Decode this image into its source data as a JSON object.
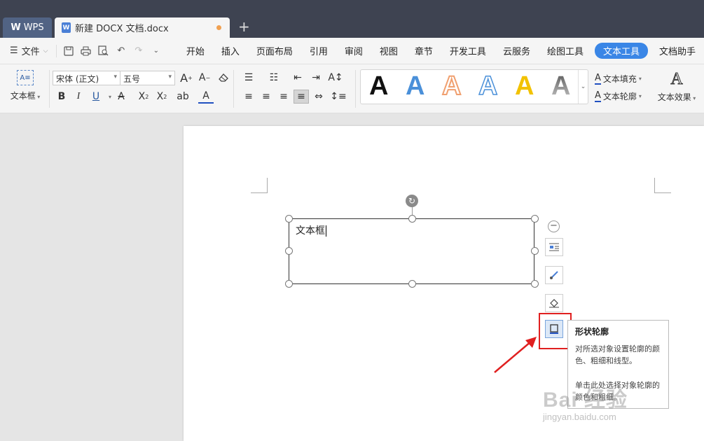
{
  "titlebar": {
    "app_tab": "WPS",
    "doc_tab": "新建 DOCX 文档.docx",
    "new_tab": "+"
  },
  "menu": {
    "file_label": "文件",
    "tabs": [
      "开始",
      "插入",
      "页面布局",
      "引用",
      "审阅",
      "视图",
      "章节",
      "开发工具",
      "云服务",
      "绘图工具",
      "文本工具",
      "文档助手"
    ],
    "active_tab": "文本工具"
  },
  "ribbon": {
    "textbox_label": "文本框",
    "font_name": "宋体 (正文)",
    "font_size": "五号",
    "text_fill": "文本填充",
    "text_outline": "文本轮廓",
    "text_effect": "文本效果",
    "style_gallery": [
      {
        "glyph": "A",
        "color": "#111111"
      },
      {
        "glyph": "A",
        "color": "#4a90d9"
      },
      {
        "glyph": "A",
        "color": "#f0a070"
      },
      {
        "glyph": "A",
        "color": "#ffffff"
      },
      {
        "glyph": "A",
        "color": "#f2c200"
      },
      {
        "glyph": "A",
        "color": "#888888"
      }
    ]
  },
  "document": {
    "textbox_text": "文本框"
  },
  "tooltip": {
    "title": "形状轮廓",
    "body": "对所选对象设置轮廓的颜色、粗细和线型。",
    "body2": "单击此处选择对象轮廓的颜色和粗细。"
  },
  "watermark": {
    "brand": "Bai 经验",
    "url": "jingyan.baidu.com"
  },
  "colors": {
    "titlebar": "#3e4351",
    "active_tab": "#3a86e6",
    "highlight": "#e02020"
  }
}
